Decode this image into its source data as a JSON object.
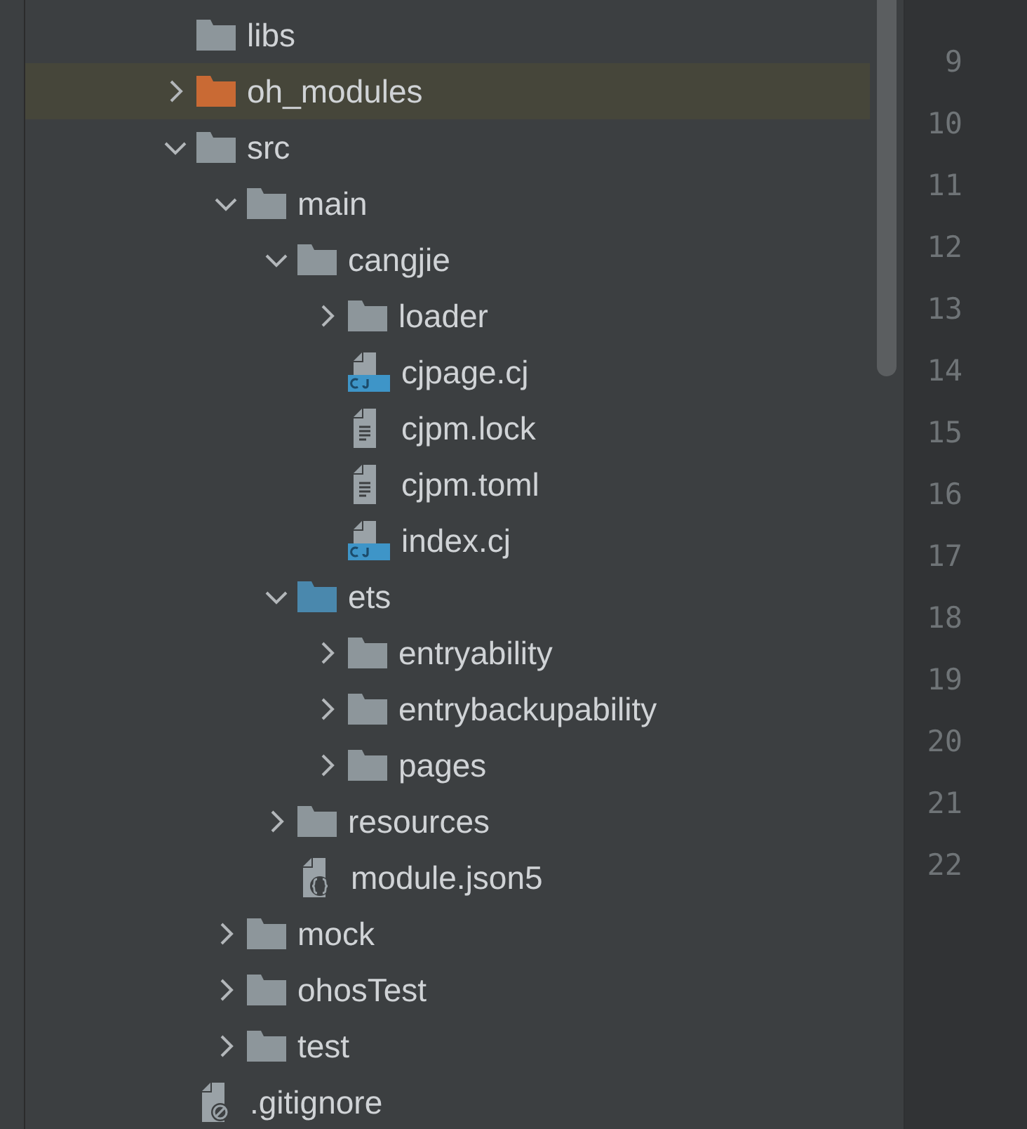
{
  "tree": [
    {
      "label": "libs",
      "kind": "folder"
    },
    {
      "label": "oh_modules",
      "kind": "excluded-folder",
      "expanded": false
    },
    {
      "label": "src",
      "kind": "folder",
      "expanded": true,
      "children": [
        {
          "label": "main",
          "kind": "folder",
          "expanded": true,
          "children": [
            {
              "label": "cangjie",
              "kind": "folder",
              "expanded": true,
              "children": [
                {
                  "label": "loader",
                  "kind": "folder",
                  "expanded": false
                },
                {
                  "label": "cjpage.cj",
                  "kind": "cj-file"
                },
                {
                  "label": "cjpm.lock",
                  "kind": "text-file"
                },
                {
                  "label": "cjpm.toml",
                  "kind": "text-file"
                },
                {
                  "label": "index.cj",
                  "kind": "cj-file"
                }
              ]
            },
            {
              "label": "ets",
              "kind": "source-folder",
              "expanded": true,
              "children": [
                {
                  "label": "entryability",
                  "kind": "folder",
                  "expanded": false
                },
                {
                  "label": "entrybackupability",
                  "kind": "folder",
                  "expanded": false
                },
                {
                  "label": "pages",
                  "kind": "folder",
                  "expanded": false
                }
              ]
            },
            {
              "label": "resources",
              "kind": "folder",
              "expanded": false
            },
            {
              "label": "module.json5",
              "kind": "json-file"
            }
          ]
        },
        {
          "label": "mock",
          "kind": "folder",
          "expanded": false
        },
        {
          "label": "ohosTest",
          "kind": "folder",
          "expanded": false
        },
        {
          "label": "test",
          "kind": "folder",
          "expanded": false
        }
      ]
    },
    {
      "label": ".gitignore",
      "kind": "ignore-file"
    }
  ],
  "line_numbers": [
    "9",
    "10",
    "11",
    "12",
    "13",
    "14",
    "15",
    "16",
    "17",
    "18",
    "19",
    "20",
    "21",
    "22"
  ]
}
